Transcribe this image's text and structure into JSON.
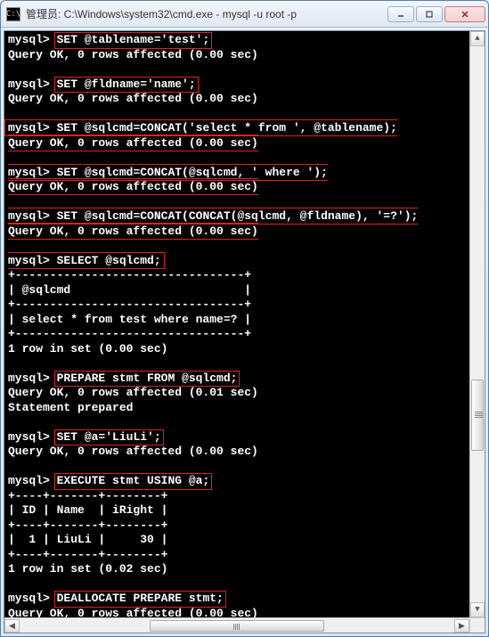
{
  "window": {
    "icon_text": "C:\\",
    "title": "管理员: C:\\Windows\\system32\\cmd.exe - mysql  -u root -p"
  },
  "prompts": {
    "mysql": "mysql>"
  },
  "lines": {
    "cmd1": "SET @tablename='test';",
    "res1": "Query OK, 0 rows affected (0.00 sec)",
    "cmd2": "SET @fldname='name';",
    "res2": "Query OK, 0 rows affected (0.00 sec)",
    "cmd3": "SET @sqlcmd=CONCAT('select * from ', @tablename);",
    "res3": "Query OK, 0 rows affected (0.00 sec)",
    "cmd4": "SET @sqlcmd=CONCAT(@sqlcmd, ' where ');",
    "res4": "Query OK, 0 rows affected (0.00 sec)",
    "cmd5": "SET @sqlcmd=CONCAT(CONCAT(@sqlcmd, @fldname), '=?');",
    "res5": "Query OK, 0 rows affected (0.00 sec)",
    "cmd6": "SELECT @sqlcmd;",
    "tbl1_border": "+---------------------------------+",
    "tbl1_head": "| @sqlcmd                         |",
    "tbl1_row": "| select * from test where name=? |",
    "tbl1_foot": "1 row in set (0.00 sec)",
    "cmd7": "PREPARE stmt FROM @sqlcmd;",
    "res7a": "Query OK, 0 rows affected (0.01 sec)",
    "res7b": "Statement prepared",
    "cmd8": "SET @a='LiuLi';",
    "res8": "Query OK, 0 rows affected (0.00 sec)",
    "cmd9": "EXECUTE stmt USING @a;",
    "tbl2_border": "+----+-------+--------+",
    "tbl2_head": "| ID | Name  | iRight |",
    "tbl2_row": "|  1 | LiuLi |     30 |",
    "tbl2_foot": "1 row in set (0.02 sec)",
    "cmd10": "DEALLOCATE PREPARE stmt;",
    "res10": "Query OK, 0 rows affected (0.00 sec)"
  }
}
